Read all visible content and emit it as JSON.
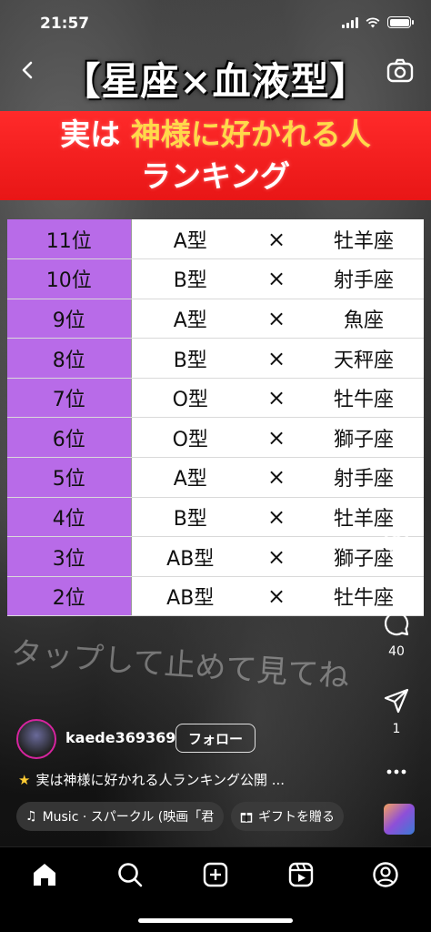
{
  "status_bar": {
    "time": "21:57"
  },
  "post": {
    "headline": "【星座×血液型】",
    "banner_prefix": "実は",
    "banner_highlight": "神様に好かれる人",
    "banner_line2": "ランキング",
    "ranking": [
      {
        "rank": "11位",
        "blood": "A型",
        "times": "×",
        "sign": "牡羊座"
      },
      {
        "rank": "10位",
        "blood": "B型",
        "times": "×",
        "sign": "射手座"
      },
      {
        "rank": "9位",
        "blood": "A型",
        "times": "×",
        "sign": "魚座"
      },
      {
        "rank": "8位",
        "blood": "B型",
        "times": "×",
        "sign": "天秤座"
      },
      {
        "rank": "7位",
        "blood": "O型",
        "times": "×",
        "sign": "牡牛座"
      },
      {
        "rank": "6位",
        "blood": "O型",
        "times": "×",
        "sign": "獅子座"
      },
      {
        "rank": "5位",
        "blood": "A型",
        "times": "×",
        "sign": "射手座"
      },
      {
        "rank": "4位",
        "blood": "B型",
        "times": "×",
        "sign": "牡羊座"
      },
      {
        "rank": "3位",
        "blood": "AB型",
        "times": "×",
        "sign": "獅子座"
      },
      {
        "rank": "2位",
        "blood": "AB型",
        "times": "×",
        "sign": "牡牛座"
      }
    ],
    "overlay_text": "タップして止めて見てね"
  },
  "actions": {
    "comments": "40",
    "shares": "1"
  },
  "author": {
    "username": "kaede369369",
    "follow_label": "フォロー"
  },
  "caption": {
    "text": "実は神様に好かれる人ランキング公開 ..."
  },
  "music": {
    "label": "Music · スパークル (映画「君"
  },
  "gift": {
    "label": "ギフトを贈る"
  },
  "colors": {
    "banner_red": "#ff2a2a",
    "highlight_yellow": "#ffd94a",
    "rank_purple": "#b86be8"
  },
  "icons": [
    "back-icon",
    "camera-icon",
    "heart-icon",
    "comment-icon",
    "share-icon",
    "more-icon",
    "music-icon",
    "gift-icon",
    "home-icon",
    "search-icon",
    "create-icon",
    "reels-icon",
    "profile-icon"
  ]
}
